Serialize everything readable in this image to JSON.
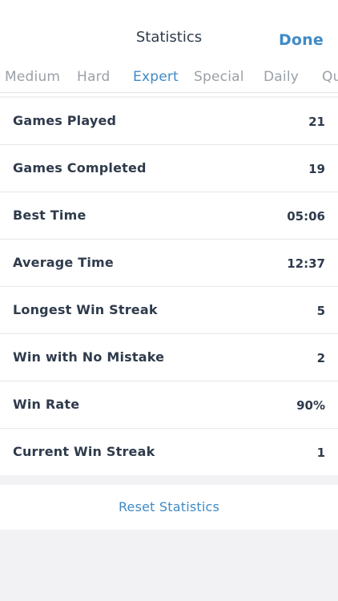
{
  "header": {
    "title": "Statistics",
    "done_label": "Done"
  },
  "tabs": [
    {
      "label": "Medium",
      "active": false
    },
    {
      "label": "Hard",
      "active": false
    },
    {
      "label": "Expert",
      "active": true
    },
    {
      "label": "Special",
      "active": false
    },
    {
      "label": "Daily",
      "active": false
    },
    {
      "label": "Qu",
      "active": false
    }
  ],
  "stats": [
    {
      "label": "Games Played",
      "value": "21"
    },
    {
      "label": "Games Completed",
      "value": "19"
    },
    {
      "label": "Best Time",
      "value": "05:06"
    },
    {
      "label": "Average Time",
      "value": "12:37"
    },
    {
      "label": "Longest Win Streak",
      "value": "5"
    },
    {
      "label": "Win with No Mistake",
      "value": "2"
    },
    {
      "label": "Win Rate",
      "value": "90%"
    },
    {
      "label": "Current Win Streak",
      "value": "1"
    }
  ],
  "actions": {
    "reset_label": "Reset Statistics"
  },
  "colors": {
    "accent": "#3f8ac6",
    "text": "#2f3b4c",
    "muted": "#9aa1a8",
    "background": "#f2f2f4"
  }
}
